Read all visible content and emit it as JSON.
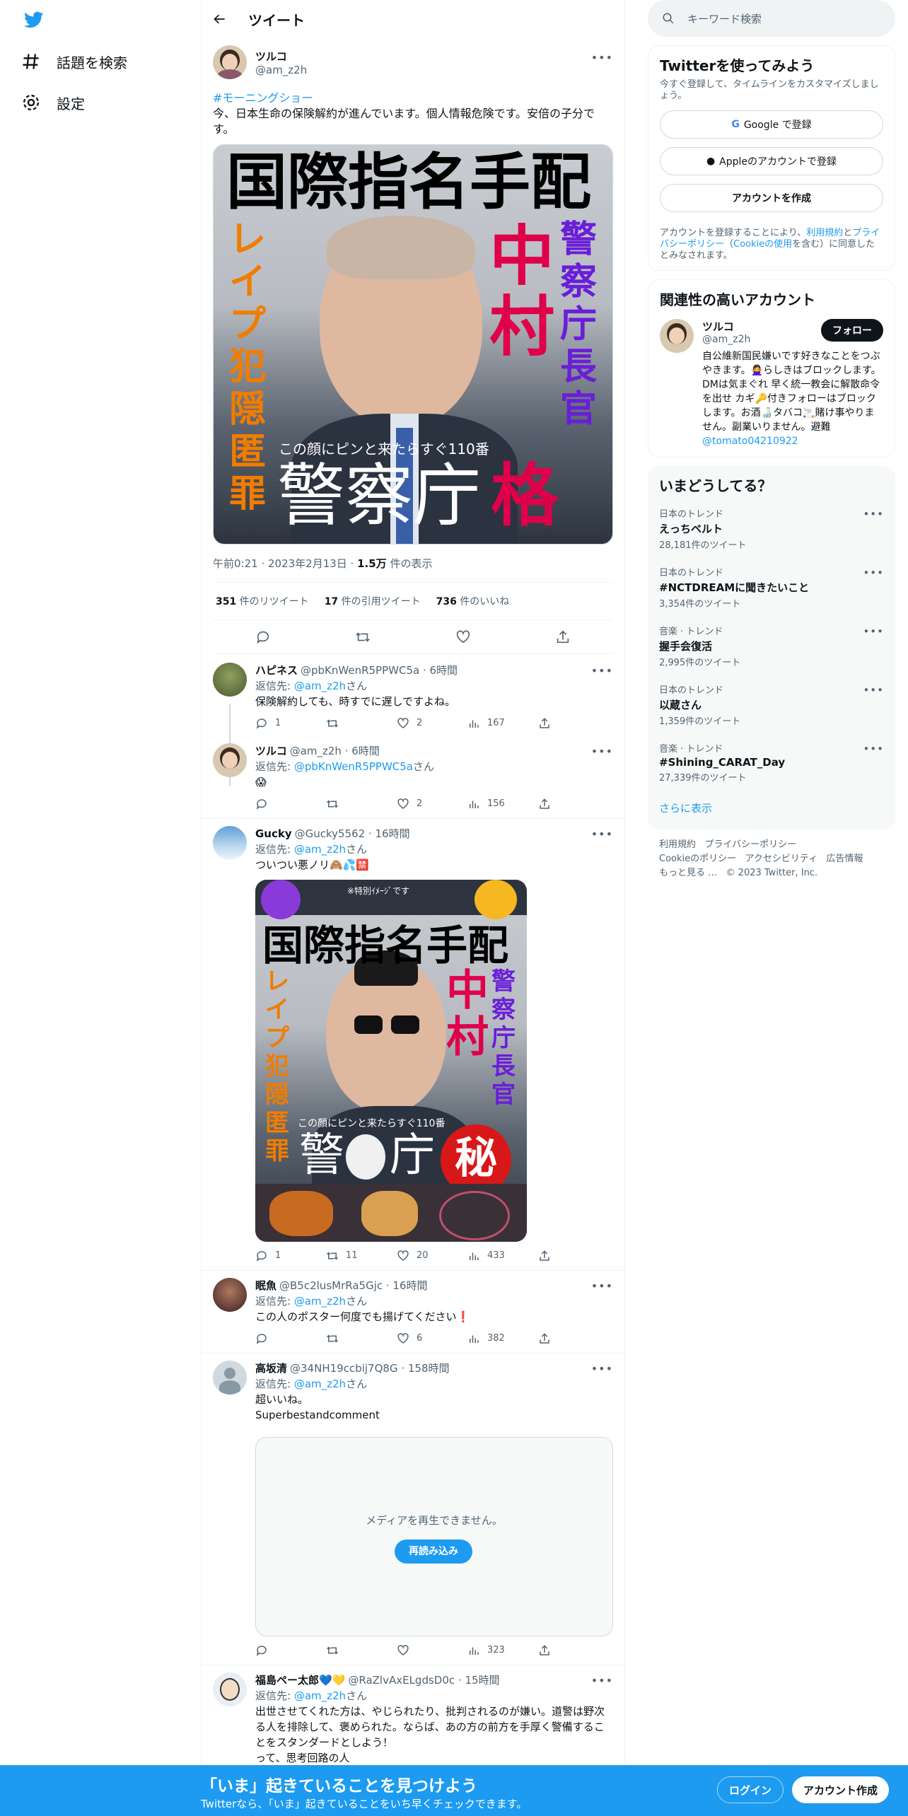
{
  "nav": {
    "explore": "話題を検索",
    "settings": "設定"
  },
  "header": {
    "title": "ツイート"
  },
  "main_tweet": {
    "name": "ツルコ",
    "handle": "@am_z2h",
    "hashtag": "#モーニングショー",
    "text": "今、日本生命の保険解約が進んでいます。個人情報危険です。安倍の子分です。",
    "poster": {
      "headline": "国際指名手配",
      "left": "レイプ犯隠匿罪",
      "right": "警察庁長官",
      "name": "中村",
      "caption": "この顔にピンと来たらすぐ110番",
      "bottom": "警察庁",
      "stamp": "格"
    },
    "time": "午前0:21 · 2023年2月13日 · ",
    "views_num": "1.5万",
    "views_label": " 件の表示",
    "retweets_num": "351",
    "retweets_label": " 件のリツイート",
    "quotes_num": "17",
    "quotes_label": " 件の引用ツイート",
    "likes_num": "736",
    "likes_label": " 件のいいね"
  },
  "replies": [
    {
      "name": "ハピネス",
      "handle": "@pbKnWenR5PPWC5a · 6時間",
      "to_label": "返信先: ",
      "to": "@am_z2h",
      "to_suffix": "さん",
      "text": "保険解約しても、時すでに遅しですよね。",
      "replies": "1",
      "retweets": "",
      "likes": "2",
      "views": "167"
    },
    {
      "name": "ツルコ",
      "handle": "@am_z2h · 6時間",
      "to_label": "返信先: ",
      "to": "@pbKnWenR5PPWC5a",
      "to_suffix": "さん",
      "text": "😱",
      "replies": "",
      "retweets": "",
      "likes": "2",
      "views": "156"
    },
    {
      "name": "Gucky",
      "handle": "@Gucky5562 · 16時間",
      "to_label": "返信先: ",
      "to": "@am_z2h",
      "to_suffix": "さん",
      "text": "ついつい悪ノリ🙈💦🈲",
      "replies": "1",
      "retweets": "11",
      "likes": "20",
      "views": "433"
    },
    {
      "name": "眠魚",
      "handle": "@B5c2lusMrRa5Gjc · 16時間",
      "to_label": "返信先: ",
      "to": "@am_z2h",
      "to_suffix": "さん",
      "text": "この人のポスター何度でも揚げてください❗️",
      "replies": "",
      "retweets": "",
      "likes": "6",
      "views": "382"
    },
    {
      "name": "高坂清",
      "handle": "@34NH19ccbij7Q8G · 158時間",
      "to_label": "返信先: ",
      "to": "@am_z2h",
      "to_suffix": "さん",
      "text": "超いいね。",
      "text2": "Superbestandcomment",
      "replies": "",
      "retweets": "",
      "likes": "",
      "views": "323"
    },
    {
      "name": "福島ペー太郎💙💛",
      "handle": "@RaZlvAxELgdsD0c · 15時間",
      "to_label": "返信先: ",
      "to": "@am_z2h",
      "to_suffix": "さん",
      "text": "出世させてくれた方は、やじられたり、批判されるのが嫌い。道警は野次る人を排除して、褒められた。ならば、あの方の前方を手厚く警備することをスタンダードとしよう！",
      "text2": "って、思考回路の人"
    }
  ],
  "gucky_poster": {
    "top": "※特別ｲﾒｰｼﾞです",
    "headline": "国際指名手配",
    "left": "レイプ犯隠匿罪",
    "right": "警察庁長官",
    "name": "中村",
    "caption": "この顔にピンと来たらすぐ110番",
    "bottom": "警",
    "bottom2": "庁",
    "stamp": "秘"
  },
  "media_error": {
    "text": "メディアを再生できません。",
    "button": "再読み込み"
  },
  "sidebar": {
    "search_placeholder": "キーワード検索",
    "signup": {
      "title": "Twitterを使ってみよう",
      "desc": "今すぐ登録して、タイムラインをカスタマイズしましょう。",
      "google": "Google で登録",
      "apple": "Appleのアカウントで登録",
      "create": "アカウントを作成",
      "terms_pre": "アカウントを登録することにより、",
      "terms_link1": "利用規約",
      "terms_mid": "と",
      "terms_link2": "プライバシーポリシー",
      "terms_paren": "（",
      "terms_link3": "Cookieの使用",
      "terms_post": "を含む）に同意したとみなされます。"
    },
    "related": {
      "title": "関連性の高いアカウント",
      "name": "ツルコ",
      "handle": "@am_z2h",
      "follow": "フォロー",
      "bio": "自公維新国民嫌いです好きなことをつぶやきます。🙅‍♀️らしきはブロックします。DMは気まぐれ 早く統一教会に解散命令を出せ カギ🔑付きフォローはブロックします。お酒🍶タバコ🚬賭け事やりません。副業いりません。避難 ",
      "bio_link": "@tomato04210922"
    },
    "trends": {
      "title": "いまどうしてる？",
      "items": [
        {
          "category": "日本のトレンド",
          "name": "えっちベルト",
          "count": "28,181件のツイート"
        },
        {
          "category": "日本のトレンド",
          "name": "#NCTDREAMに聞きたいこと",
          "count": "3,354件のツイート"
        },
        {
          "category": "音楽 · トレンド",
          "name": "握手会復活",
          "count": "2,995件のツイート"
        },
        {
          "category": "日本のトレンド",
          "name": "以蔵さん",
          "count": "1,359件のツイート"
        },
        {
          "category": "音楽 · トレンド",
          "name": "#Shining_CARAT_Day",
          "count": "27,339件のツイート"
        }
      ],
      "more": "さらに表示"
    },
    "footer": {
      "l1": "利用規約",
      "l2": "プライバシーポリシー",
      "l3": "Cookieのポリシー",
      "l4": "アクセシビリティ",
      "l5": "広告情報",
      "l6": "もっと見る …",
      "copy": "© 2023 Twitter, Inc."
    }
  },
  "bottom_bar": {
    "title": "「いま」起きていることを見つけよう",
    "sub": "Twitterなら、「いま」起きていることをいち早くチェックできます。",
    "login": "ログイン",
    "signup": "アカウント作成"
  },
  "colors": {
    "accent": "#1d9bf0",
    "text": "#0f1419",
    "muted": "#536471",
    "border": "#eff3f4"
  }
}
